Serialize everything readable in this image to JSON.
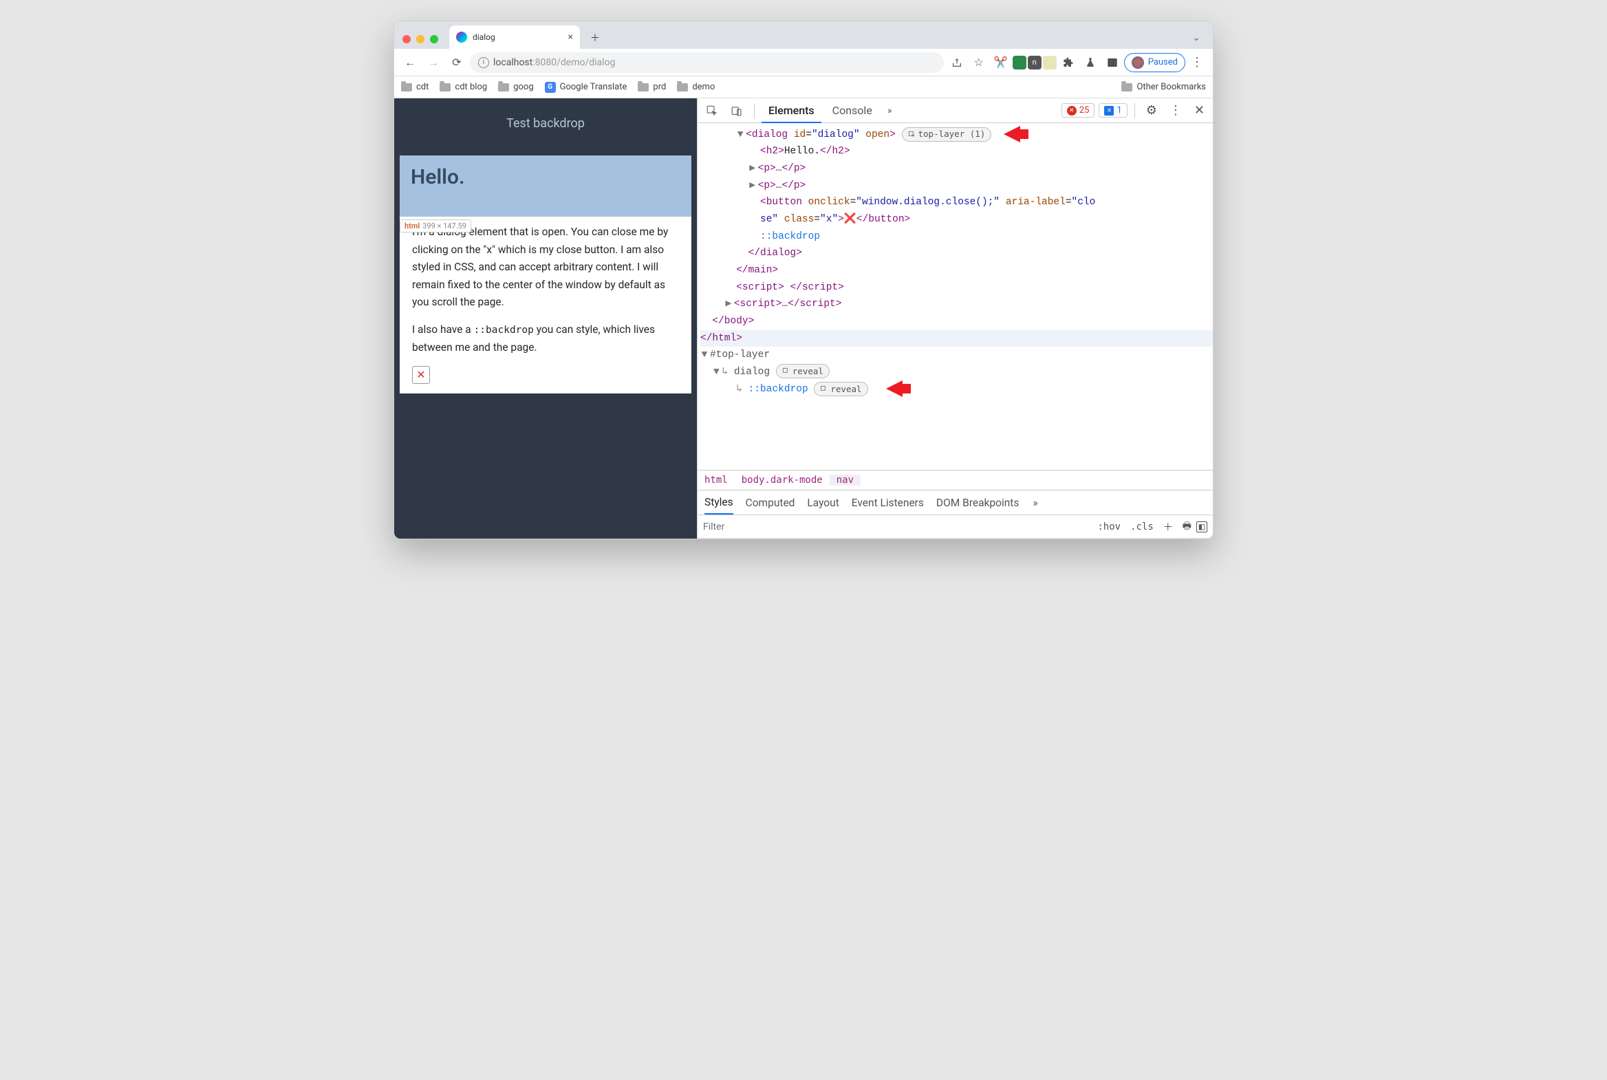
{
  "tab": {
    "title": "dialog"
  },
  "url": {
    "prefix": "localhost",
    "port": ":8080",
    "path": "/demo/dialog"
  },
  "profile": {
    "status": "Paused"
  },
  "bookmarks": {
    "items": [
      "cdt",
      "cdt blog",
      "goog",
      "Google Translate",
      "prd",
      "demo"
    ],
    "other": "Other Bookmarks"
  },
  "page": {
    "banner": "Test backdrop",
    "h2": "Hello.",
    "dim_label": "html",
    "dim_value": "399 × 147.59",
    "p1": "I'm a dialog element that is open. You can close me by clicking on the \"x\" which is my close button. I am also styled in CSS, and can accept arbitrary content. I will remain fixed to the center of the window by default as you scroll the page.",
    "p2_a": "I also have a ",
    "p2_code": "::backdrop",
    "p2_b": " you can style, which lives between me and the page.",
    "close_glyph": "✕"
  },
  "devtools": {
    "tabs": {
      "elements": "Elements",
      "console": "Console"
    },
    "errors": "25",
    "messages": "1",
    "top_layer_badge": "top-layer (1)",
    "reveal": "reveal",
    "tree": {
      "dialog_open": "<dialog id=\"dialog\" open>",
      "h2": "<h2>Hello.</h2>",
      "p": "<p>…</p>",
      "btn_a": "<button onclick=\"window.dialog.close();\" aria-label=\"clo",
      "btn_b": "se\" class=\"x\">",
      "btn_x": "❌",
      "btn_c": "</button>",
      "backdrop": "::backdrop",
      "dialog_close": "</dialog>",
      "main_close": "</main>",
      "script1": "<script> </script>",
      "script2": "<script>…</script>",
      "body_close": "</body>",
      "html_close": "</html>",
      "toplayer": "#top-layer",
      "tl_dialog": "dialog",
      "tl_backdrop": "::backdrop"
    },
    "crumb": {
      "a": "html",
      "b": "body.dark-mode",
      "c": "nav"
    },
    "sp": {
      "styles": "Styles",
      "computed": "Computed",
      "layout": "Layout",
      "listeners": "Event Listeners",
      "breakpoints": "DOM Breakpoints",
      "filter_ph": "Filter",
      "hov": ":hov",
      "cls": ".cls"
    }
  }
}
